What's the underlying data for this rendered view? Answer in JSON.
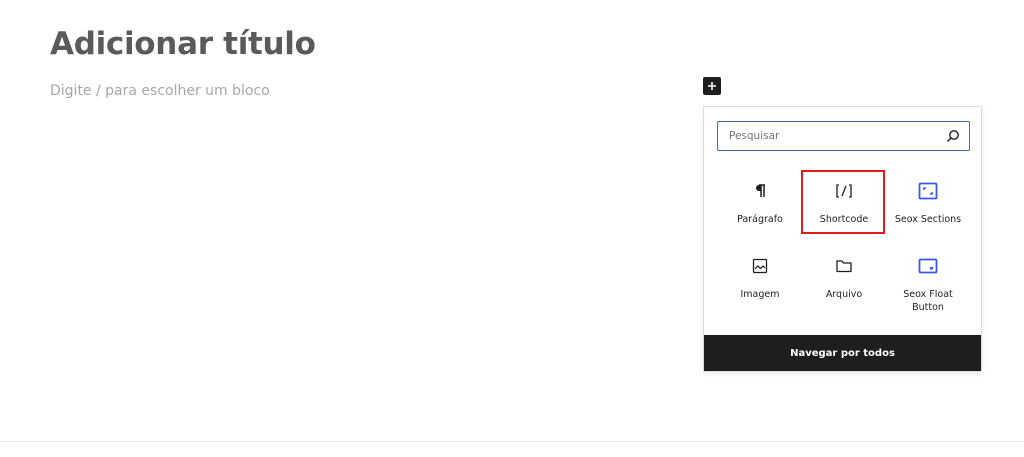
{
  "editor": {
    "title_placeholder": "Adicionar título",
    "block_placeholder": "Digite / para escolher um bloco"
  },
  "inserter": {
    "toggle_icon": "plus-icon",
    "search": {
      "placeholder": "Pesquisar",
      "value": "",
      "icon": "search-icon"
    },
    "blocks": [
      {
        "label": "Parágrafo",
        "icon": "paragraph-icon"
      },
      {
        "label": "Shortcode",
        "icon": "shortcode-icon"
      },
      {
        "label": "Seox Sections",
        "icon": "seox-sections-icon"
      },
      {
        "label": "Imagem",
        "icon": "image-icon"
      },
      {
        "label": "Arquivo",
        "icon": "folder-icon"
      },
      {
        "label": "Seox Float Button",
        "icon": "seox-float-button-icon"
      }
    ],
    "highlighted_block": "Shortcode",
    "browse_all_label": "Navegar por todos"
  },
  "colors": {
    "accent_blue": "#3d6fa8",
    "seox_icon": "#3858e9",
    "highlight_red": "#e01c1c",
    "dark": "#1e1e1e"
  }
}
